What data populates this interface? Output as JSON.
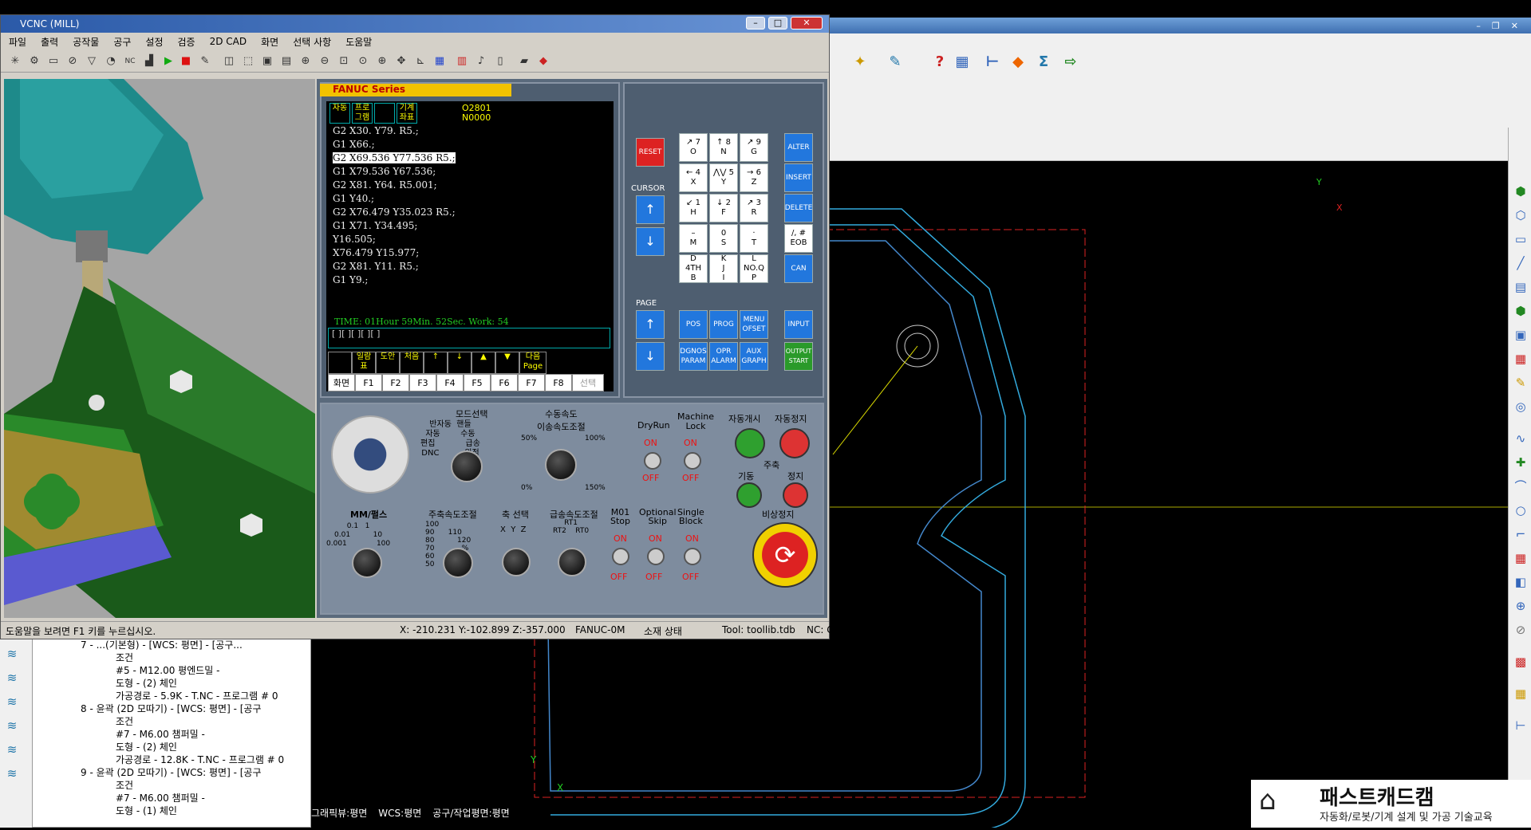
{
  "vcnc": {
    "title": "VCNC (MILL)",
    "menu": [
      "파일",
      "출력",
      "공작물",
      "공구",
      "설정",
      "검증",
      "2D CAD",
      "화면",
      "선택 사항",
      "도움말"
    ],
    "status": {
      "help": "도움말을 보려면 F1 키를 누르십시오.",
      "coords": "X: -210.231  Y:-102.899  Z:-357.000",
      "control": "FANUC-0M",
      "material": "소재 상태",
      "tool": "Tool: toollib.tdb",
      "nc": "NC: C"
    }
  },
  "fanuc": {
    "header": "FANUC  Series",
    "tabs": [
      "자동",
      "프로\n그램",
      "",
      "기계\n좌표"
    ],
    "prog_no": "O2801",
    "seq_no": "N0000",
    "lines": [
      "G2 X30. Y79. R5.;",
      "G1 X66.;",
      "G2 X69.536 Y77.536 R5.;",
      "G1 X79.536 Y67.536;",
      "G2 X81. Y64. R5.001;",
      "G1 Y40.;",
      "G2 X76.479 Y35.023 R5.;",
      "G1 X71. Y34.495;",
      "Y16.505;",
      "X76.479 Y15.977;",
      "G2 X81. Y11. R5.;",
      "G1 Y9.;"
    ],
    "time": "TIME: 01Hour 59Min. 52Sec.  Work: 54",
    "input_line": "[  ][  ][  ][  ][  ]",
    "soft_tabs": [
      "",
      "일람\n표",
      "도안",
      "처음",
      "↑",
      "↓",
      "▲",
      "▼",
      "다음\nPage"
    ],
    "fkeys": [
      "화면",
      "F1",
      "F2",
      "F3",
      "F4",
      "F5",
      "F6",
      "F7",
      "F8",
      "선택"
    ]
  },
  "keypad": {
    "reset": "RESET",
    "cursor": "CURSOR",
    "page": "PAGE",
    "keys": [
      [
        "↗ 7\nO",
        "↑ 8\nN",
        "↗ 9\nG"
      ],
      [
        "← 4\nX",
        "⋀⋁ 5\nY",
        "→ 6\nZ"
      ],
      [
        "↙ 1\nH",
        "↓ 2\nF",
        "↗ 3\nR"
      ],
      [
        "–\nM",
        "0\nS",
        "·\nT"
      ],
      [
        "D\n4TH\nB",
        "K\nJ\nI",
        "L\nNO.Q\nP"
      ]
    ],
    "edit": [
      "ALTER",
      "INSERT",
      "DELETE",
      "/, #\nEOB",
      "CAN"
    ],
    "func": [
      "POS",
      "PROG",
      "MENU\nOFSET",
      "DGNOS\nPARAM",
      "OPR\nALARM",
      "AUX\nGRAPH"
    ],
    "input": "INPUT",
    "output": "OUTPUT\nSTART"
  },
  "panel": {
    "mode": "모드선택",
    "mode_opts": "반자동  핸들\n자동        수동\n편집            급송\nDNC          원점",
    "feed": "수동속도\n이송속도조절",
    "feed_min": "0%",
    "feed_50": "50%",
    "feed_100": "100%",
    "feed_150": "150%",
    "dryrun": "DryRun",
    "machine_lock": "Machine\nLock",
    "on": "ON",
    "off": "OFF",
    "auto_start": "자동개시",
    "auto_stop": "자동정지",
    "spindle": "주축",
    "spindle_start": "기동",
    "spindle_stop": "정지",
    "mm": "MM/펄스",
    "mm_vals": "0.1   1\n0.01          10\n0.001             100",
    "spindle_ovr": "주축속도조절",
    "spindle_vals": "100\n90      110\n80          120\n70            %\n60\n50",
    "axis": "축 선택",
    "axis_vals": "X  Y  Z",
    "rapid": "급송속도조절",
    "rapid_vals": "RT1\nRT2    RT0",
    "m01": "M01\nStop",
    "opt_skip": "Optional\nSkip",
    "single": "Single\nBlock",
    "estop": "비상정지"
  },
  "tree": [
    "7 - ...(기본형) - [WCS: 평면] - [공구...",
    "조건",
    "#5 - M12.00 평엔드밀 -",
    "도형 - (2) 체인",
    "가공경로 - 5.9K - T.NC - 프로그램 # 0",
    "8 - 윤곽 (2D 모따기) - [WCS: 평면] - [공구",
    "조건",
    "#7 - M6.00 챔퍼밀 -",
    "도형 - (2) 체인",
    "가공경로 - 12.8K - T.NC - 프로그램 # 0",
    "9 - 윤곽 (2D 모따기) - [WCS: 평면] - [공구",
    "조건",
    "#7 - M6.00 챔퍼밀 -",
    "도형 - (1) 체인"
  ],
  "cad_status": [
    "그래픽뷰:평면",
    "WCS:평면",
    "공구/작업평면:평면"
  ],
  "logo": {
    "title": "패스트캐드캠",
    "sub": "자동화/로봇/기계 설계 및 가공 기술교육"
  },
  "colors": {
    "accent": "#2b5aa8",
    "fanuc_yellow": "#f2c200",
    "key_blue": "#2277dd",
    "green": "#2a9a2a",
    "red": "#dd3322"
  }
}
